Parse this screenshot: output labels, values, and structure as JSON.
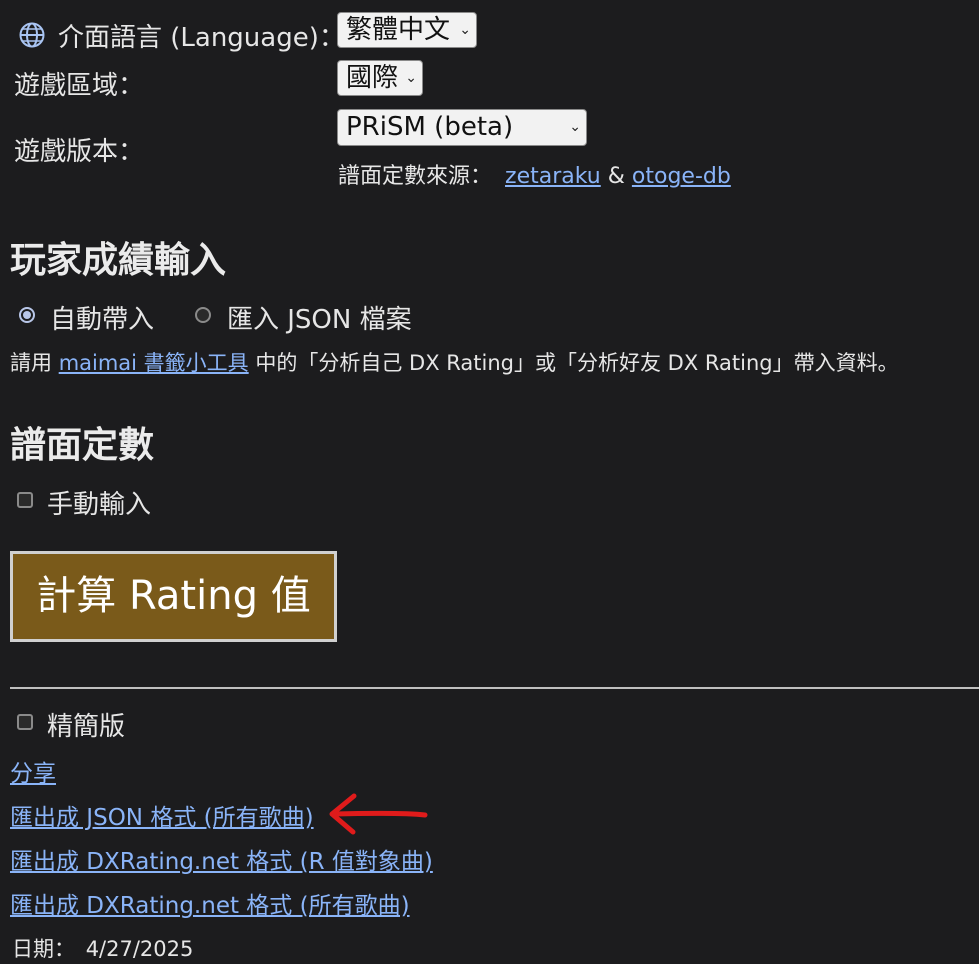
{
  "settings": {
    "language_label": "介面語言 (Language)：",
    "language_value": "繁體中文",
    "region_label": "遊戲區域：",
    "region_value": "國際",
    "version_label": "遊戲版本：",
    "version_value": "PRiSM (beta)",
    "chart_source_label": "譜面定數來源：",
    "source_link_1": "zetaraku",
    "source_sep": "&",
    "source_link_2": "otoge-db"
  },
  "score_input": {
    "heading": "玩家成績輸入",
    "option_auto": "自動帶入",
    "option_json": "匯入 JSON 檔案",
    "selected_option": "自動帶入",
    "hint_prefix": "請用",
    "hint_link": "maimai 書籤小工具",
    "hint_suffix": "中的「分析自己 DX Rating」或「分析好友 DX Rating」帶入資料。"
  },
  "chart_constant": {
    "heading": "譜面定數",
    "manual_label": "手動輸入",
    "manual_checked": false
  },
  "calculate_button": {
    "label": "計算 Rating 值",
    "color": "#7a5a1a"
  },
  "output": {
    "compact_label": "精簡版",
    "compact_checked": false,
    "share_link": "分享",
    "export_json": "匯出成 JSON 格式 (所有歌曲)",
    "export_dx_r": "匯出成 DXRating.net 格式 (R 值對象曲)",
    "export_dx_all": "匯出成 DXRating.net 格式 (所有歌曲)",
    "date_label": "日期：",
    "date_value": "4/27/2025"
  },
  "annotation": {
    "arrow_color": "#e01b1b"
  },
  "icons": {
    "globe": "globe-icon",
    "chevron": "chevron-down-icon"
  }
}
